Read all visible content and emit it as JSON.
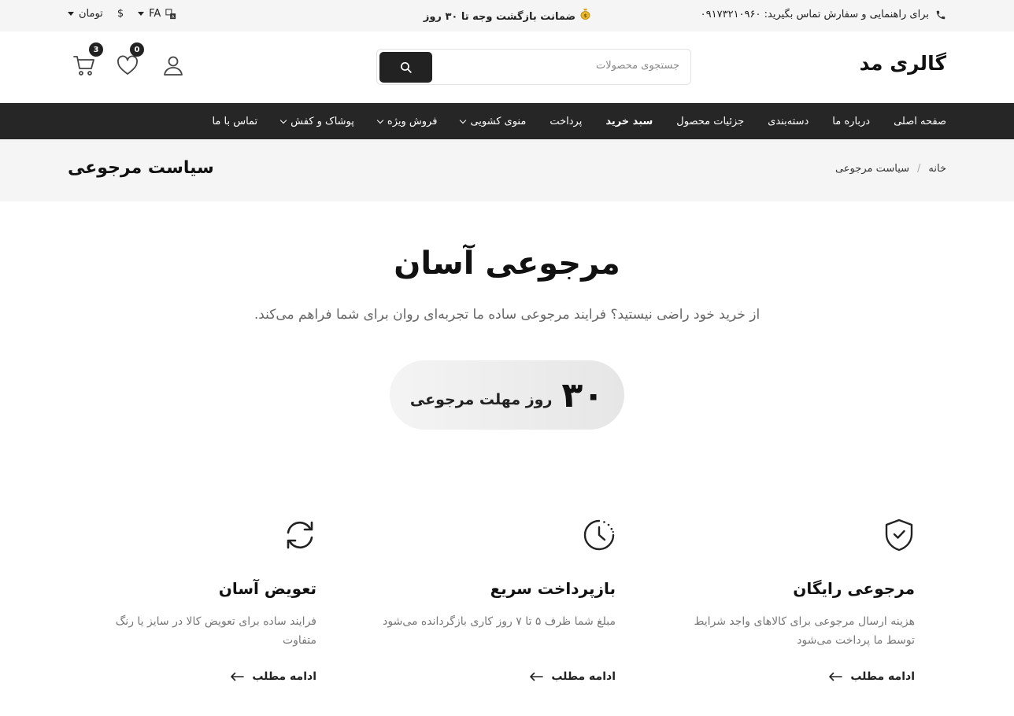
{
  "topbar": {
    "phone_text": "برای راهنمایی و سفارش تماس بگیرید: ۰۹۱۷۳۲۱۰۹۶۰",
    "guarantee": "ضمانت بازگشت وجه تا ۳۰ روز",
    "language": "FA",
    "currency_symbol": "$",
    "currency": "تومان"
  },
  "header": {
    "logo": "گالری مد",
    "search_placeholder": "جستجوی محصولات",
    "wishlist_count": "0",
    "cart_count": "3"
  },
  "nav": {
    "items": [
      {
        "label": "صفحه اصلی"
      },
      {
        "label": "درباره ما"
      },
      {
        "label": "دسته‌بندی"
      },
      {
        "label": "جزئیات محصول"
      },
      {
        "label": "سبد خرید"
      },
      {
        "label": "پرداخت"
      },
      {
        "label": "منوی کشویی"
      },
      {
        "label": "فروش ویژه"
      },
      {
        "label": "پوشاک و کفش"
      },
      {
        "label": "تماس با ما"
      }
    ]
  },
  "pagehead": {
    "breadcrumb_home": "خانه",
    "breadcrumb_sep": "/",
    "breadcrumb_current": "سیاست مرجوعی",
    "title": "سیاست مرجوعی"
  },
  "hero": {
    "title": "مرجوعی آسان",
    "subtitle": "از خرید خود راضی نیستید؟ فرایند مرجوعی ساده ما تجربه‌ای روان برای شما فراهم می‌کند.",
    "badge_number": "۳۰",
    "badge_label": "روز مهلت مرجوعی"
  },
  "features": [
    {
      "icon": "shield-check-icon",
      "title": "مرجوعی رایگان",
      "desc": "هزینه ارسال مرجوعی برای کالاهای واجد شرایط توسط ما پرداخت می‌شود",
      "link": "ادامه مطلب"
    },
    {
      "icon": "clock-icon",
      "title": "بازپرداخت سریع",
      "desc": "مبلغ شما ظرف ۵ تا ۷ روز کاری بازگردانده می‌شود",
      "link": "ادامه مطلب"
    },
    {
      "icon": "refresh-icon",
      "title": "تعویض آسان",
      "desc": "فرایند ساده برای تعویض کالا در سایز یا رنگ متفاوت",
      "link": "ادامه مطلب"
    }
  ]
}
